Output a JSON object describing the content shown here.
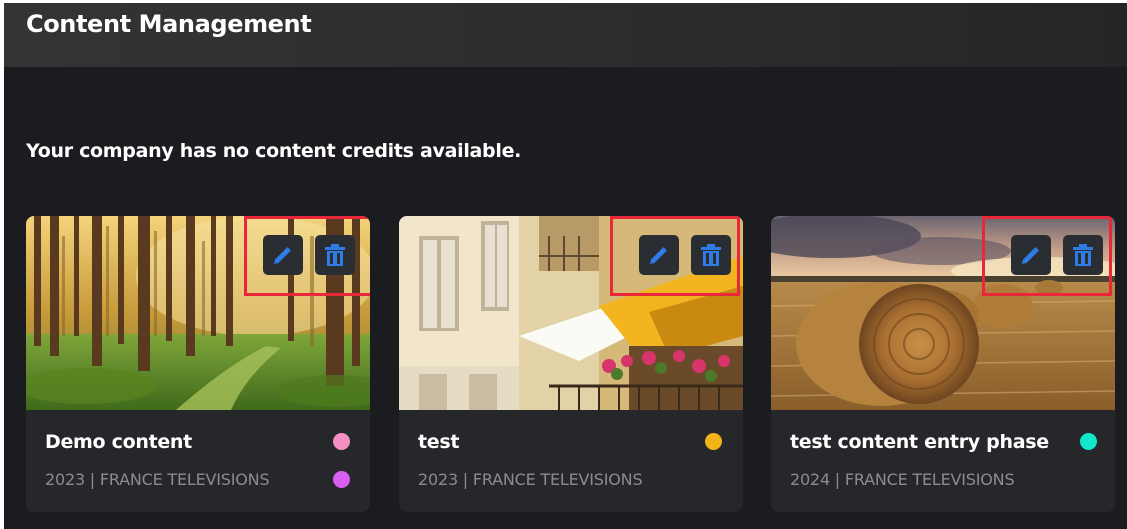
{
  "header": {
    "title": "Content Management"
  },
  "notice": "Your company has no content credits available.",
  "colors": {
    "accent_blue": "#2f7be8",
    "highlight_red": "#e8283a"
  },
  "cards": [
    {
      "title": "Demo content",
      "meta": "2023 | FRANCE TELEVISIONS",
      "image": "forest-path",
      "dots": [
        "#f48fc4",
        "#d95ef2"
      ],
      "actions": {
        "edit_icon": "pencil-icon",
        "delete_icon": "trash-icon"
      }
    },
    {
      "title": "test",
      "meta": "2023 | FRANCE TELEVISIONS",
      "image": "building-facade",
      "dots": [
        "#f2b418"
      ],
      "actions": {
        "edit_icon": "pencil-icon",
        "delete_icon": "trash-icon"
      }
    },
    {
      "title": "test content entry phase",
      "meta": "2024 | FRANCE TELEVISIONS",
      "image": "hay-bales-field",
      "dots": [
        "#10e8c9"
      ],
      "actions": {
        "edit_icon": "pencil-icon",
        "delete_icon": "trash-icon"
      }
    }
  ]
}
